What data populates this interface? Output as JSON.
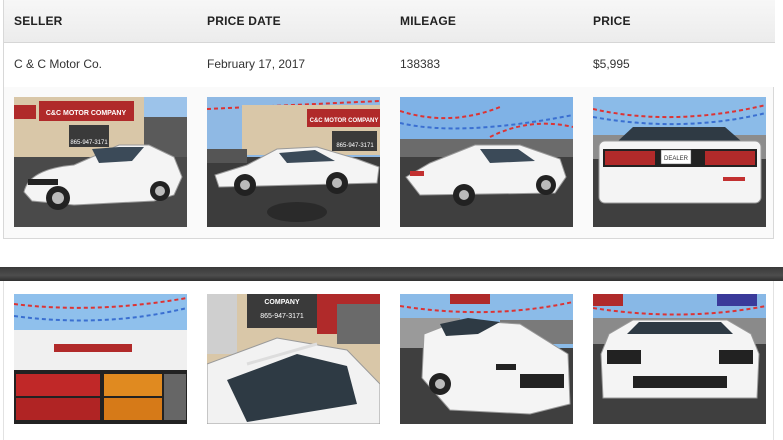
{
  "table": {
    "headers": [
      "SELLER",
      "PRICE DATE",
      "MILEAGE",
      "PRICE"
    ],
    "row": {
      "seller": "C & C Motor Co.",
      "price_date": "February 17, 2017",
      "mileage": "138383",
      "price": "$5,995"
    }
  },
  "photos": {
    "row1": [
      {
        "name": "car-photo-front-quarter",
        "sign_text": "C&C MOTOR COMPANY",
        "phone": "865-947-3171"
      },
      {
        "name": "car-photo-side",
        "sign_text": "C&C MOTOR COMPANY",
        "phone": "865-947-3171"
      },
      {
        "name": "car-photo-rear-quarter"
      },
      {
        "name": "car-photo-rear",
        "plate": "DEALER"
      }
    ],
    "row2": [
      {
        "name": "car-photo-taillight"
      },
      {
        "name": "car-photo-roof",
        "sign_text": "COMPANY",
        "phone": "865-947-3171"
      },
      {
        "name": "car-photo-front-left"
      },
      {
        "name": "car-photo-front"
      }
    ]
  },
  "colors": {
    "car_white": "#f4f4f4",
    "asphalt": "#3c3c3c",
    "sky": "#7fb2e6",
    "building_red": "#b02a2a"
  }
}
